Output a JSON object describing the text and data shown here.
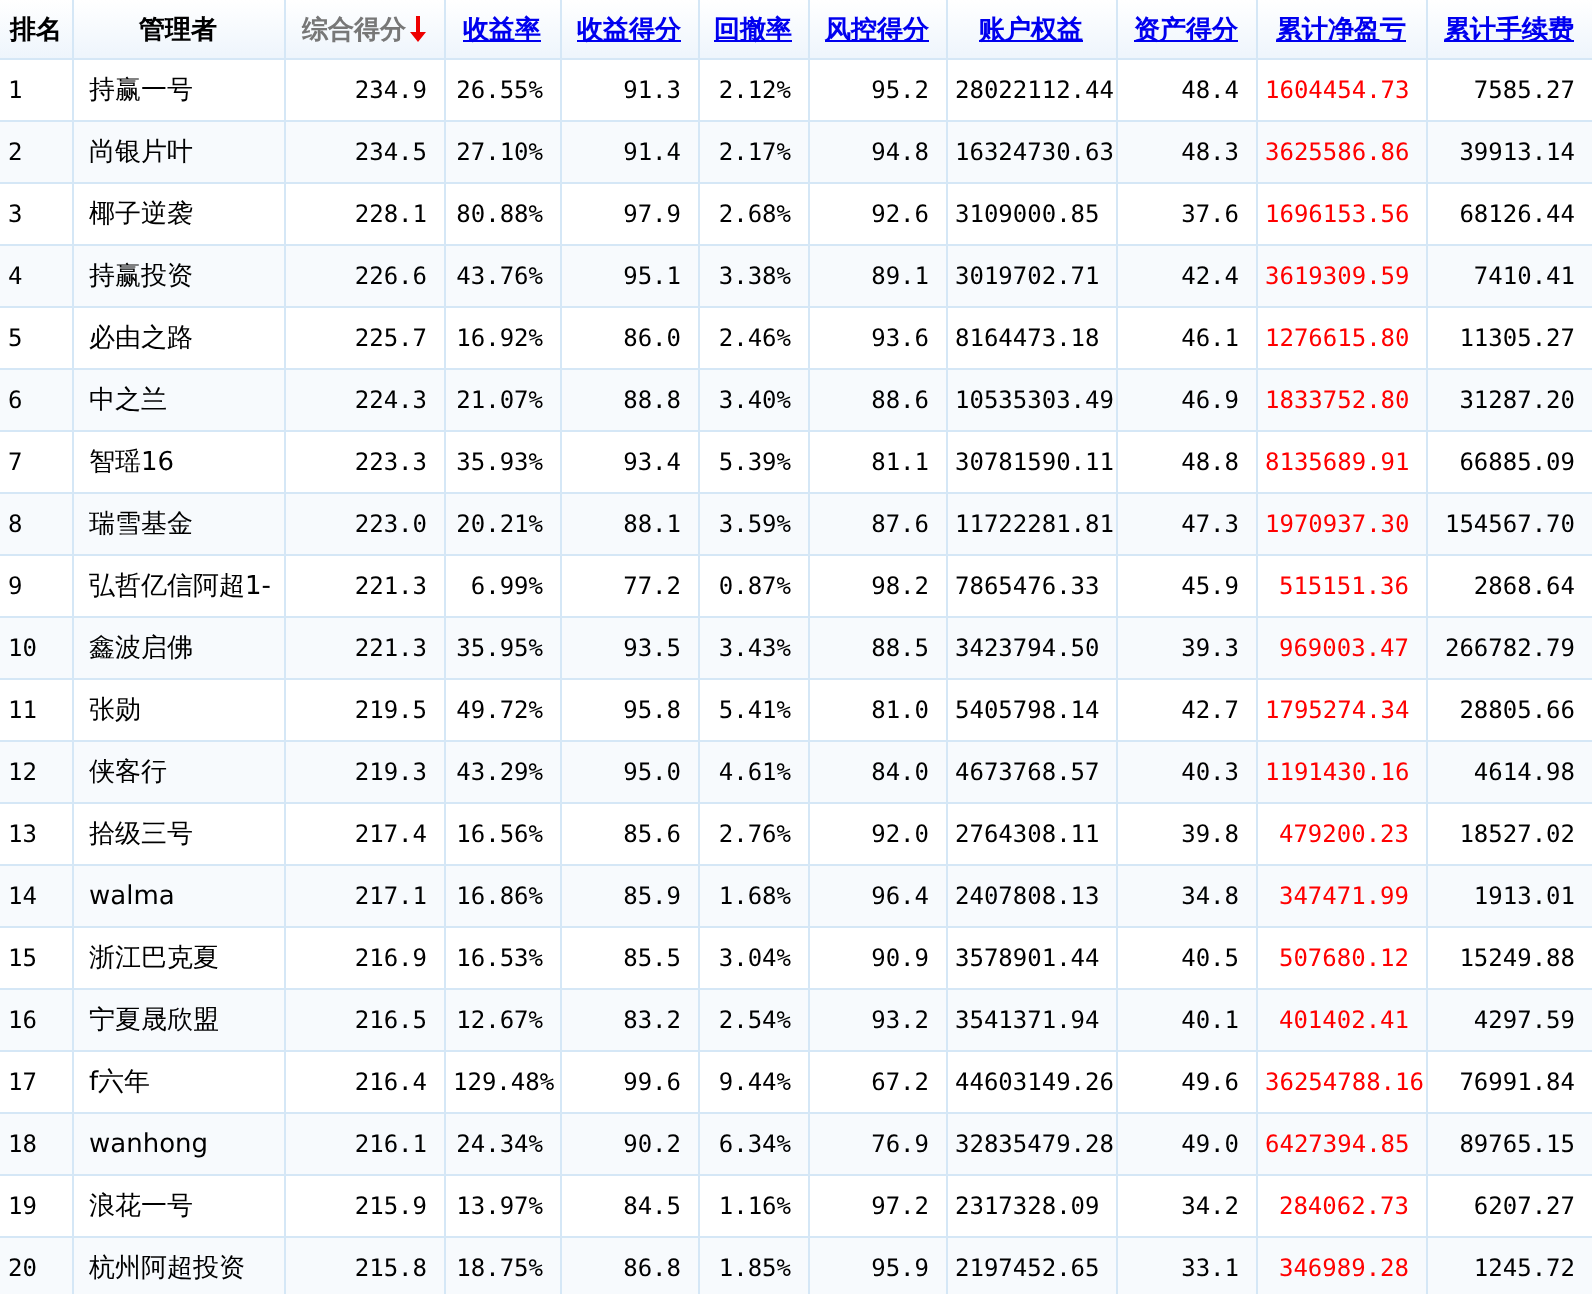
{
  "table": {
    "columns": [
      {
        "label": "排名",
        "kind": "plain",
        "color": "#000000"
      },
      {
        "label": "管理者",
        "kind": "plain",
        "color": "#000000"
      },
      {
        "label": "综合得分",
        "kind": "sort",
        "sorted": true,
        "color": "#000000"
      },
      {
        "label": "收益率",
        "kind": "link",
        "sorted": false,
        "color": "#000000"
      },
      {
        "label": "收益得分",
        "kind": "link",
        "sorted": false,
        "color": "#000000"
      },
      {
        "label": "回撤率",
        "kind": "link",
        "sorted": false,
        "color": "#000000"
      },
      {
        "label": "风控得分",
        "kind": "link",
        "sorted": false,
        "color": "#000000"
      },
      {
        "label": "账户权益",
        "kind": "link",
        "sorted": false,
        "color": "#000000"
      },
      {
        "label": "资产得分",
        "kind": "link",
        "sorted": false,
        "color": "#000000"
      },
      {
        "label": "累计净盈亏",
        "kind": "link",
        "sorted": false,
        "color": "#ff0000"
      },
      {
        "label": "累计手续费",
        "kind": "link",
        "sorted": false,
        "color": "#000000"
      }
    ],
    "rows": [
      [
        "1",
        "持赢一号",
        "234.9",
        "26.55%",
        "91.3",
        "2.12%",
        "95.2",
        "28022112.44",
        "48.4",
        "1604454.73",
        "7585.27"
      ],
      [
        "2",
        "尚银片叶",
        "234.5",
        "27.10%",
        "91.4",
        "2.17%",
        "94.8",
        "16324730.63",
        "48.3",
        "3625586.86",
        "39913.14"
      ],
      [
        "3",
        "椰子逆袭",
        "228.1",
        "80.88%",
        "97.9",
        "2.68%",
        "92.6",
        "3109000.85",
        "37.6",
        "1696153.56",
        "68126.44"
      ],
      [
        "4",
        "持赢投资",
        "226.6",
        "43.76%",
        "95.1",
        "3.38%",
        "89.1",
        "3019702.71",
        "42.4",
        "3619309.59",
        "7410.41"
      ],
      [
        "5",
        "必由之路",
        "225.7",
        "16.92%",
        "86.0",
        "2.46%",
        "93.6",
        "8164473.18",
        "46.1",
        "1276615.80",
        "11305.27"
      ],
      [
        "6",
        "中之兰",
        "224.3",
        "21.07%",
        "88.8",
        "3.40%",
        "88.6",
        "10535303.49",
        "46.9",
        "1833752.80",
        "31287.20"
      ],
      [
        "7",
        "智瑶16",
        "223.3",
        "35.93%",
        "93.4",
        "5.39%",
        "81.1",
        "30781590.11",
        "48.8",
        "8135689.91",
        "66885.09"
      ],
      [
        "8",
        "瑞雪基金",
        "223.0",
        "20.21%",
        "88.1",
        "3.59%",
        "87.6",
        "11722281.81",
        "47.3",
        "1970937.30",
        "154567.70"
      ],
      [
        "9",
        "弘哲亿信阿超1-",
        "221.3",
        "6.99%",
        "77.2",
        "0.87%",
        "98.2",
        "7865476.33",
        "45.9",
        "515151.36",
        "2868.64"
      ],
      [
        "10",
        "鑫波启佛",
        "221.3",
        "35.95%",
        "93.5",
        "3.43%",
        "88.5",
        "3423794.50",
        "39.3",
        "969003.47",
        "266782.79"
      ],
      [
        "11",
        "张勋",
        "219.5",
        "49.72%",
        "95.8",
        "5.41%",
        "81.0",
        "5405798.14",
        "42.7",
        "1795274.34",
        "28805.66"
      ],
      [
        "12",
        "侠客行",
        "219.3",
        "43.29%",
        "95.0",
        "4.61%",
        "84.0",
        "4673768.57",
        "40.3",
        "1191430.16",
        "4614.98"
      ],
      [
        "13",
        "拾级三号",
        "217.4",
        "16.56%",
        "85.6",
        "2.76%",
        "92.0",
        "2764308.11",
        "39.8",
        "479200.23",
        "18527.02"
      ],
      [
        "14",
        "walma",
        "217.1",
        "16.86%",
        "85.9",
        "1.68%",
        "96.4",
        "2407808.13",
        "34.8",
        "347471.99",
        "1913.01"
      ],
      [
        "15",
        "浙江巴克夏",
        "216.9",
        "16.53%",
        "85.5",
        "3.04%",
        "90.9",
        "3578901.44",
        "40.5",
        "507680.12",
        "15249.88"
      ],
      [
        "16",
        "宁夏晟欣盟",
        "216.5",
        "12.67%",
        "83.2",
        "2.54%",
        "93.2",
        "3541371.94",
        "40.1",
        "401402.41",
        "4297.59"
      ],
      [
        "17",
        "f六年",
        "216.4",
        "129.48%",
        "99.6",
        "9.44%",
        "67.2",
        "44603149.26",
        "49.6",
        "36254788.16",
        "76991.84"
      ],
      [
        "18",
        "wanhong",
        "216.1",
        "24.34%",
        "90.2",
        "6.34%",
        "76.9",
        "32835479.28",
        "49.0",
        "6427394.85",
        "89765.15"
      ],
      [
        "19",
        "浪花一号",
        "215.9",
        "13.97%",
        "84.5",
        "1.16%",
        "97.2",
        "2317328.09",
        "34.2",
        "284062.73",
        "6207.27"
      ],
      [
        "20",
        "杭州阿超投资",
        "215.8",
        "18.75%",
        "86.8",
        "1.85%",
        "95.9",
        "2197452.65",
        "33.1",
        "346989.28",
        "1245.72"
      ]
    ]
  }
}
